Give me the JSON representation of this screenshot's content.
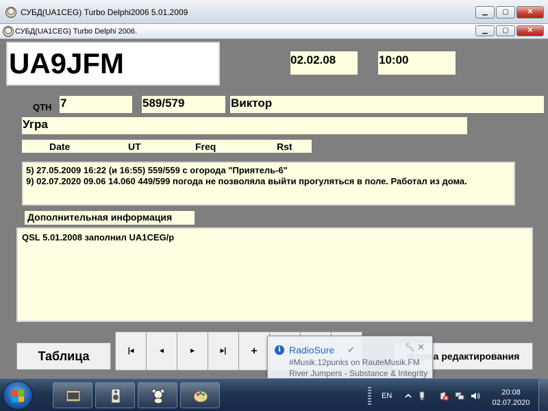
{
  "outer_window": {
    "title": "СУБД(UA1CEG) Turbo Delphi2006  5.01.2009",
    "controls": {
      "minimize": "▁",
      "maximize": "▢",
      "close": "✕"
    }
  },
  "mdi_window": {
    "title": "СУБД(UA1CEG) Turbo Delphi 2006.",
    "controls": {
      "minimize": "▁",
      "maximize": "▢",
      "close": "✕"
    }
  },
  "record": {
    "callsign": "UA9JFM",
    "date": "02.02.08",
    "time": "10:00",
    "qth_label": "QTH",
    "qth": "7",
    "rst": "589/579",
    "name": "Виктор",
    "location": "Угра"
  },
  "history_columns": [
    "Date",
    "UT",
    "Freq",
    "Rst"
  ],
  "history_lines": [
    "5) 27.05.2009 16:22 (и 16:55) 559/559 с огорода \"Приятель-6\"",
    "9) 02.07.2020  09.06 14.060 449/599  погода не позволяла  выйти прогуляться в поле. Работал из дома."
  ],
  "additional_info": {
    "label": "Дополнительная информация",
    "text": "QSL 5.01.2008 заполнил UA1CEG/p"
  },
  "buttons": {
    "table": "Таблица",
    "first": "|◂",
    "prior": "◂",
    "next": "▸",
    "last": "▸|",
    "insert": "+",
    "edit_form": "Форма редактирования"
  },
  "notification": {
    "title": "RadioSure",
    "line1": "#Musik.12punks on RauteMusik.FM",
    "line2": "River Jumpers - Substance & Integrity",
    "icons": [
      "info-icon",
      "check-icon",
      "wrench-icon",
      "close-icon"
    ]
  },
  "taskbar": {
    "pinned": [
      "app-window-icon",
      "speaker-icon",
      "teddy-bear-icon",
      "paint-palette-icon"
    ],
    "language": "EN",
    "clock_time": "20:08",
    "clock_date": "02.07.2020",
    "tray_icons": [
      "usb-icon",
      "action-center-icon",
      "network-icon",
      "volume-icon"
    ]
  },
  "colors": {
    "form_bg": "#7f7f7f",
    "field_bg": "#ffffe1",
    "taskbar": "#1f3450",
    "notification_title": "#2a63c4"
  }
}
